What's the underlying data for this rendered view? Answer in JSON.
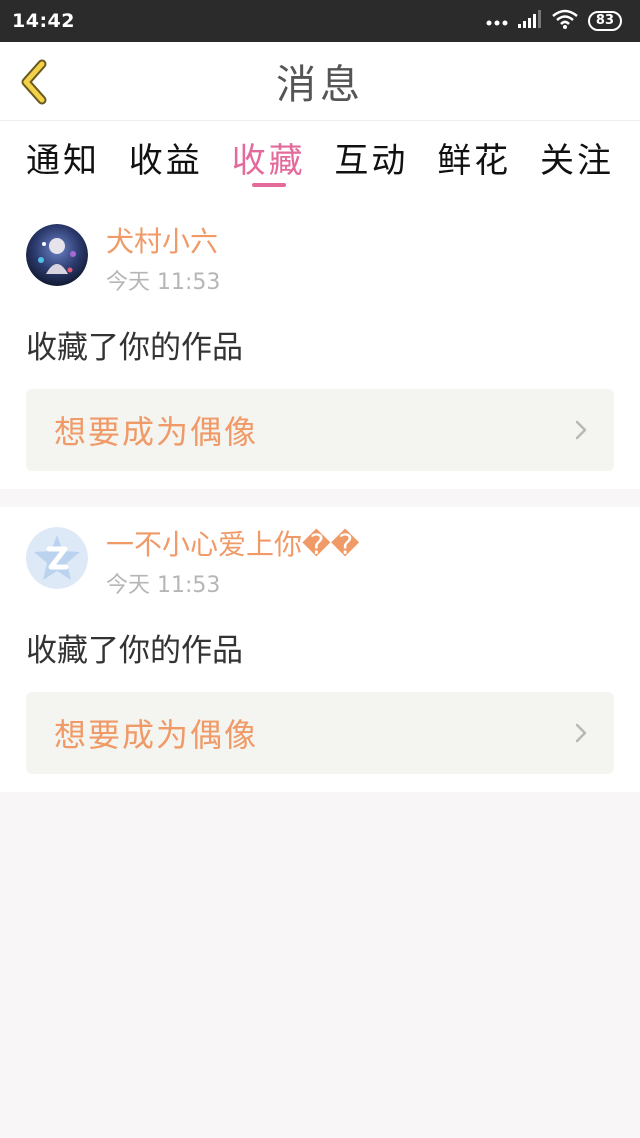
{
  "status_bar": {
    "time": "14:42",
    "battery": "83"
  },
  "header": {
    "title": "消息"
  },
  "tabs": [
    {
      "label": "通知",
      "active": false
    },
    {
      "label": "收益",
      "active": false
    },
    {
      "label": "收藏",
      "active": true
    },
    {
      "label": "互动",
      "active": false
    },
    {
      "label": "鲜花",
      "active": false
    },
    {
      "label": "关注",
      "active": false
    }
  ],
  "messages": [
    {
      "username": "犬村小六",
      "time": "今天 11:53",
      "action": "收藏了你的作品",
      "work_title": "想要成为偶像"
    },
    {
      "username": "一不小心爱上你��",
      "time": "今天 11:53",
      "action": "收藏了你的作品",
      "work_title": "想要成为偶像"
    }
  ],
  "colors": {
    "accent": "#e36a9b",
    "username": "#ef9a67",
    "status_bar": "#2b2b2b",
    "page_bg": "#f8f6f6"
  }
}
